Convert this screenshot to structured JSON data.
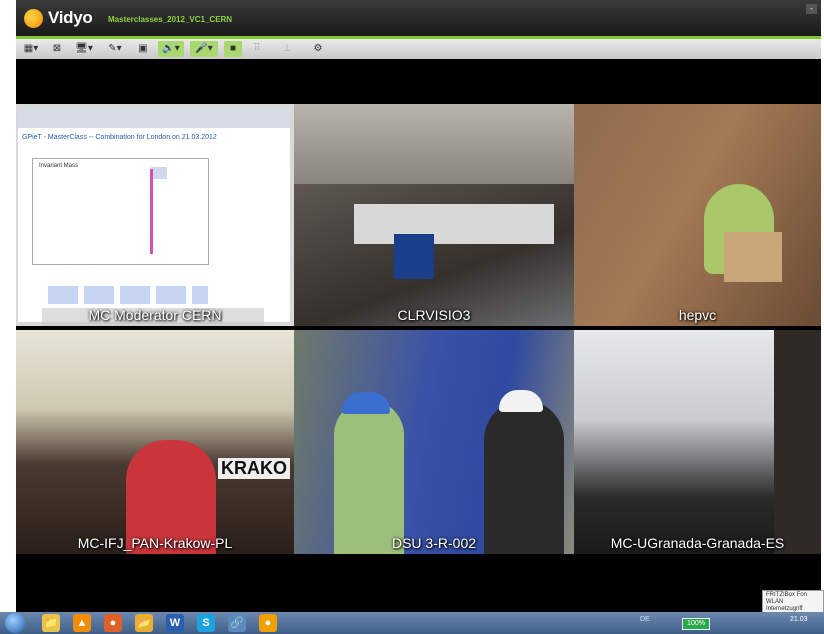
{
  "app": {
    "brand": "Vidyo",
    "conference": "Masterclasses_2012_VC1_CERN",
    "minimize": "-"
  },
  "toolbar": [
    {
      "name": "layout-button",
      "glyph": "▦▾",
      "highlight": false,
      "disabled": false
    },
    {
      "name": "fullscreen-button",
      "glyph": "⊠",
      "highlight": false,
      "disabled": false
    },
    {
      "name": "monitor-button",
      "glyph": "🖥▾",
      "highlight": false,
      "disabled": false
    },
    {
      "name": "share-button",
      "glyph": "✎▾",
      "highlight": false,
      "disabled": false
    },
    {
      "name": "selfview-button",
      "glyph": "▣",
      "highlight": false,
      "disabled": false
    },
    {
      "name": "speaker-button",
      "glyph": "🔊▾",
      "highlight": true,
      "disabled": false
    },
    {
      "name": "microphone-button",
      "glyph": "🎤▾",
      "highlight": true,
      "disabled": false
    },
    {
      "name": "camera-button",
      "glyph": "■",
      "highlight": true,
      "disabled": false
    },
    {
      "name": "dialpad-button",
      "glyph": "⠿",
      "highlight": false,
      "disabled": true
    },
    {
      "name": "network-button",
      "glyph": "⊥",
      "highlight": false,
      "disabled": true
    },
    {
      "name": "settings-button",
      "glyph": "⚙",
      "highlight": false,
      "disabled": false
    }
  ],
  "tiles": [
    {
      "label": "MC Moderator CERN",
      "kind": "screen"
    },
    {
      "label": "CLRVISIO3",
      "kind": "room"
    },
    {
      "label": "hepvc",
      "kind": "person"
    },
    {
      "label": "MC-IFJ_PAN-Krakow-PL",
      "kind": "audience"
    },
    {
      "label": "DSU 3-R-002",
      "kind": "tunnel"
    },
    {
      "label": "MC-UGranada-Granada-ES",
      "kind": "classroom"
    }
  ],
  "shared_screen": {
    "title": "GPieT - MasterClass -- Combination for London on 21.03.2012",
    "plot_title": "Invariant Mass"
  },
  "audience_sign": "KRAKO",
  "taskbar": {
    "apps": [
      {
        "name": "explorer-taskbar-icon",
        "glyph": "📁",
        "color": "#e8c44a"
      },
      {
        "name": "vlc-taskbar-icon",
        "glyph": "▲",
        "color": "#f28c00"
      },
      {
        "name": "firefox-taskbar-icon",
        "glyph": "●",
        "color": "#e0602a"
      },
      {
        "name": "folder-taskbar-icon",
        "glyph": "📂",
        "color": "#e8b030"
      },
      {
        "name": "word-taskbar-icon",
        "glyph": "W",
        "color": "#2b5eb0"
      },
      {
        "name": "skype-taskbar-icon",
        "glyph": "S",
        "color": "#1aa3e0"
      },
      {
        "name": "network-taskbar-icon",
        "glyph": "🔗",
        "color": "#5a8abf"
      },
      {
        "name": "vidyo-taskbar-icon",
        "glyph": "●",
        "color": "#f2a000"
      }
    ],
    "lang": "DE",
    "battery": "100%",
    "time": "21.03"
  },
  "notification": {
    "line1": "FRITZ!Box Fon WLAN",
    "line2": "Internetzugriff"
  }
}
